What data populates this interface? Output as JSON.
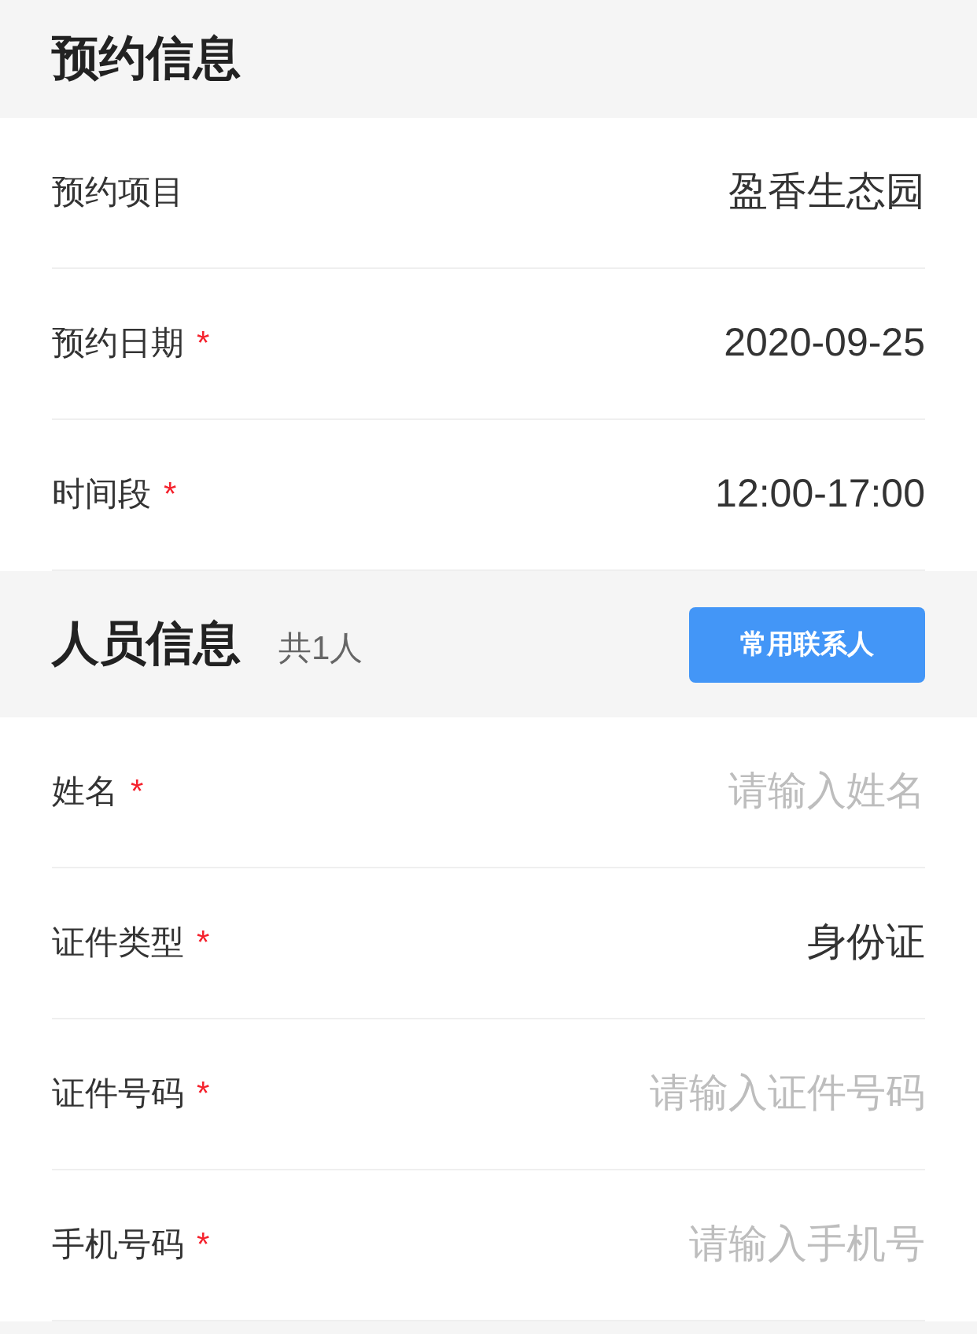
{
  "sections": [
    {
      "title": "预约信息",
      "rows": [
        {
          "kind": "text",
          "label": "预约项目",
          "value": "盈香生态园"
        },
        {
          "kind": "text",
          "label": "预约日期",
          "required_mark": "*",
          "value": "2020-09-25"
        },
        {
          "kind": "text",
          "label": "时间段",
          "required_mark": "*",
          "value": "12:00-17:00"
        }
      ]
    },
    {
      "title": "人员信息",
      "count": "共1人",
      "button": "常用联系人",
      "rows": [
        {
          "kind": "input",
          "label": "姓名",
          "required_mark": "*",
          "placeholder": "请输入姓名"
        },
        {
          "kind": "text",
          "label": "证件类型",
          "required_mark": "*",
          "value": "身份证"
        },
        {
          "kind": "input",
          "label": "证件号码",
          "required_mark": "*",
          "placeholder": "请输入证件号码"
        },
        {
          "kind": "input",
          "label": "手机号码",
          "required_mark": "*",
          "placeholder": "请输入手机号"
        }
      ]
    }
  ]
}
